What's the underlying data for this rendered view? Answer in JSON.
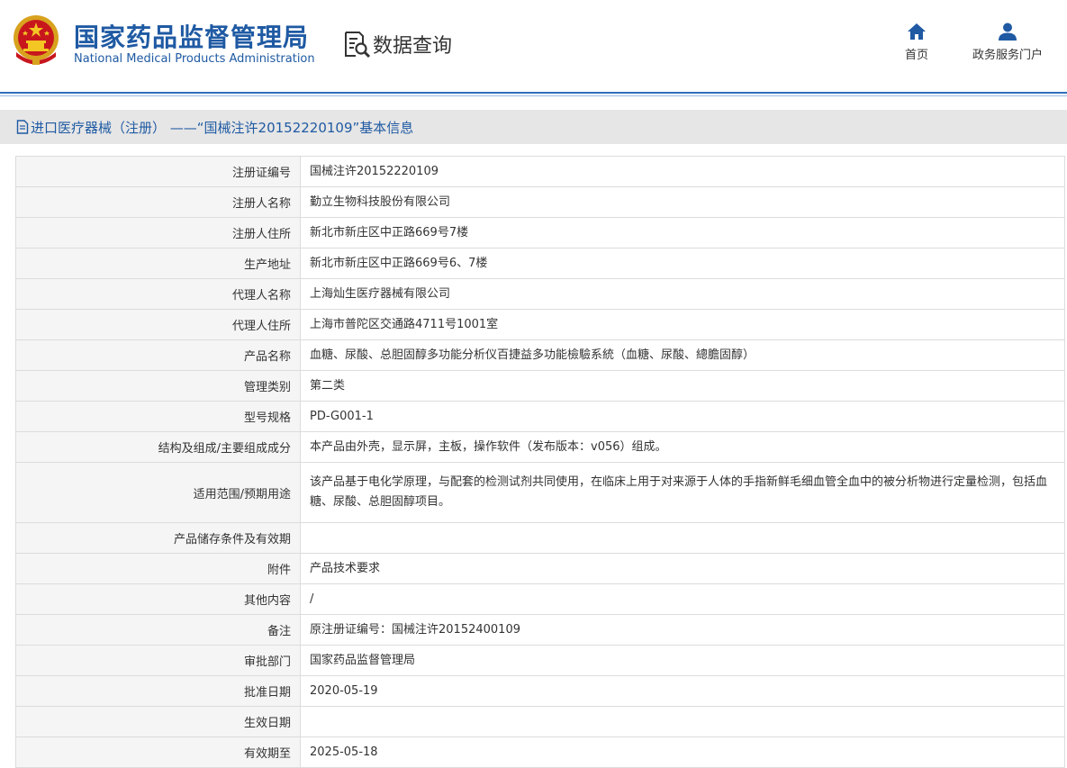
{
  "header": {
    "org_name_cn": "国家药品监督管理局",
    "org_name_en": "National Medical Products Administration",
    "section_title": "数据查询",
    "nav": [
      {
        "label": "首页",
        "icon": "home-icon"
      },
      {
        "label": "政务服务门户",
        "icon": "user-icon"
      }
    ]
  },
  "page_title": "进口医疗器械（注册） ——“国械注许20152220109”基本信息",
  "colors": {
    "brand_blue": "#1f5aa3",
    "header_rule": "#2f6fba",
    "title_bar_bg": "#e6e6e6",
    "label_bg": "#f5f5f5",
    "border": "#dcdcdc"
  },
  "rows": [
    {
      "label": "注册证编号",
      "value": "国械注许20152220109"
    },
    {
      "label": "注册人名称",
      "value": "勤立生物科技股份有限公司"
    },
    {
      "label": "注册人住所",
      "value": "新北市新庄区中正路669号7楼"
    },
    {
      "label": "生产地址",
      "value": "新北市新庄区中正路669号6、7楼"
    },
    {
      "label": "代理人名称",
      "value": "上海灿生医疗器械有限公司"
    },
    {
      "label": "代理人住所",
      "value": "上海市普陀区交通路4711号1001室"
    },
    {
      "label": "产品名称",
      "value": "血糖、尿酸、总胆固醇多功能分析仪百捷益多功能檢驗系統（血糖、尿酸、總膽固醇）"
    },
    {
      "label": "管理类别",
      "value": "第二类"
    },
    {
      "label": "型号规格",
      "value": "PD-G001-1"
    },
    {
      "label": "结构及组成/主要组成成分",
      "value": "本产品由外壳，显示屏，主板，操作软件（发布版本：v056）组成。"
    },
    {
      "label": "适用范围/预期用途",
      "value": "该产品基于电化学原理，与配套的检测试剂共同使用，在临床上用于对来源于人体的手指新鲜毛细血管全血中的被分析物进行定量检测，包括血糖、尿酸、总胆固醇项目。"
    },
    {
      "label": "产品储存条件及有效期",
      "value": ""
    },
    {
      "label": "附件",
      "value": "产品技术要求"
    },
    {
      "label": "其他内容",
      "value": "/"
    },
    {
      "label": "备注",
      "value": "原注册证编号：国械注许20152400109"
    },
    {
      "label": "审批部门",
      "value": "国家药品监督管理局"
    },
    {
      "label": "批准日期",
      "value": "2020-05-19"
    },
    {
      "label": "生效日期",
      "value": ""
    },
    {
      "label": "有效期至",
      "value": "2025-05-18"
    }
  ]
}
